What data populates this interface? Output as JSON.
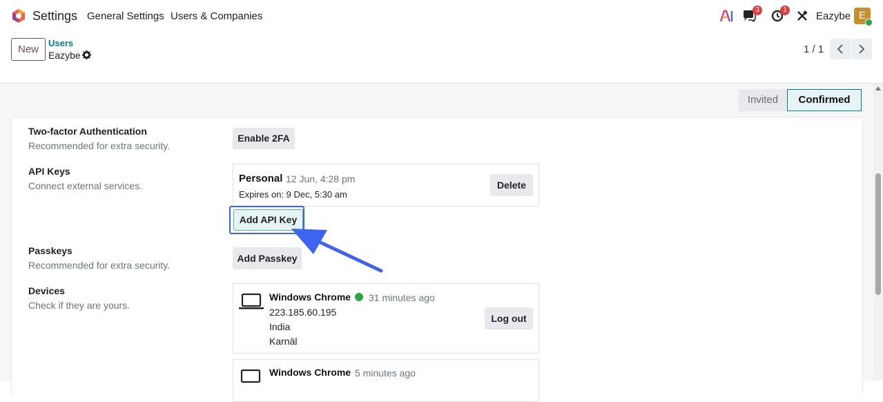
{
  "topbar": {
    "app_title": "Settings",
    "menu": [
      "General Settings",
      "Users & Companies"
    ],
    "chat_badge": "3",
    "activity_badge": "1",
    "username": "Eazybe",
    "avatar_letter": "E"
  },
  "control": {
    "new_label": "New",
    "breadcrumb_parent": "Users",
    "breadcrumb_current": "Eazybe",
    "pager": "1 / 1"
  },
  "status": {
    "stages": [
      "Invited",
      "Confirmed"
    ],
    "active": "Confirmed"
  },
  "security": {
    "two_factor": {
      "label": "Two-factor Authentication",
      "help": "Recommended for extra security.",
      "button": "Enable 2FA"
    },
    "api_keys": {
      "label": "API Keys",
      "help": "Connect external services.",
      "key": {
        "name": "Personal",
        "created": "12 Jun, 4:28 pm",
        "expires": "Expires on: 9 Dec, 5:30 am",
        "delete_label": "Delete"
      },
      "add_label": "Add API Key"
    },
    "passkeys": {
      "label": "Passkeys",
      "help": "Recommended for extra security.",
      "button": "Add Passkey"
    },
    "devices": {
      "label": "Devices",
      "help": "Check if they are yours.",
      "items": [
        {
          "name": "Windows Chrome",
          "time": "31 minutes ago",
          "ip": "223.185.60.195",
          "country": "India",
          "city": "Karnāl",
          "logout_label": "Log out",
          "active": true
        },
        {
          "name": "Windows Chrome",
          "time": "5 minutes ago"
        }
      ]
    }
  },
  "colors": {
    "brand": "#714b67",
    "accent": "#017e84",
    "annotation": "#3c64f0",
    "online": "#28a745"
  }
}
